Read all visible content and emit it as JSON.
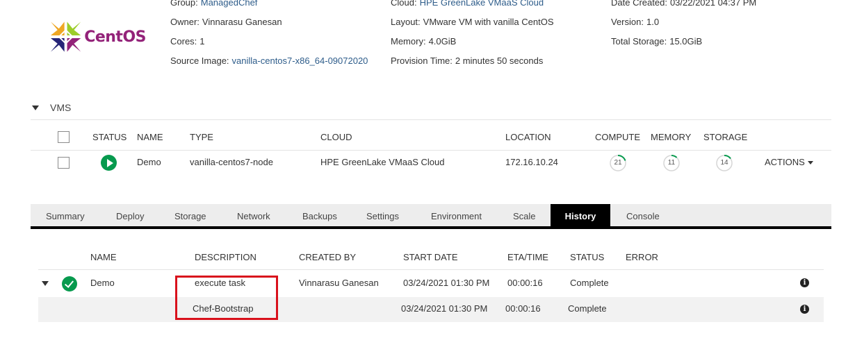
{
  "logo": {
    "text": "CentOS"
  },
  "info": {
    "col1": [
      {
        "key": "Group:",
        "value": "ManagedChef",
        "link": true
      },
      {
        "key": "Owner:",
        "value": "Vinnarasu Ganesan",
        "link": false
      },
      {
        "key": "Cores:",
        "value": "1",
        "link": false
      },
      {
        "key": "Source Image:",
        "value": "vanilla-centos7-x86_64-09072020",
        "link": true
      }
    ],
    "col2": [
      {
        "key": "Cloud:",
        "value": "HPE GreenLake VMaaS Cloud",
        "link": true
      },
      {
        "key": "Layout:",
        "value": "VMware VM with vanilla CentOS",
        "link": false
      },
      {
        "key": "Memory:",
        "value": "4.0GiB",
        "link": false
      },
      {
        "key": "Provision Time:",
        "value": "2 minutes 50 seconds",
        "link": false
      }
    ],
    "col3": [
      {
        "key": "Date Created:",
        "value": "03/22/2021 04:37 PM",
        "link": false
      },
      {
        "key": "Version:",
        "value": "1.0",
        "link": false
      },
      {
        "key": "Total Storage:",
        "value": "15.0GiB",
        "link": false
      }
    ]
  },
  "vms": {
    "section_label": "VMS",
    "columns": {
      "status": "STATUS",
      "name": "NAME",
      "type": "TYPE",
      "cloud": "CLOUD",
      "location": "LOCATION",
      "compute": "COMPUTE",
      "memory": "MEMORY",
      "storage": "STORAGE"
    },
    "rows": [
      {
        "name": "Demo",
        "type": "vanilla-centos7-node",
        "cloud": "HPE GreenLake VMaaS Cloud",
        "location": "172.16.10.24",
        "compute": "21",
        "memory": "11",
        "storage": "14",
        "actions": "ACTIONS"
      }
    ]
  },
  "tabs": [
    "Summary",
    "Deploy",
    "Storage",
    "Network",
    "Backups",
    "Settings",
    "Environment",
    "Scale",
    "History",
    "Console"
  ],
  "active_tab": "History",
  "history": {
    "columns": {
      "name": "NAME",
      "description": "DESCRIPTION",
      "created_by": "CREATED BY",
      "start_date": "START DATE",
      "eta_time": "ETA/TIME",
      "status": "STATUS",
      "error": "ERROR"
    },
    "rows": [
      {
        "name": "Demo",
        "description": "execute task",
        "created_by": "Vinnarasu Ganesan",
        "start_date": "03/24/2021 01:30 PM",
        "eta_time": "00:00:16",
        "status": "Complete",
        "error": ""
      },
      {
        "name": "",
        "description": "Chef-Bootstrap",
        "created_by": "",
        "start_date": "03/24/2021 01:30 PM",
        "eta_time": "00:00:16",
        "status": "Complete",
        "error": ""
      }
    ]
  },
  "colors": {
    "status_green": "#079a4e",
    "link_blue": "#2d5c8a",
    "highlight_red": "#d9111c",
    "active_tab_bg": "#000000"
  }
}
